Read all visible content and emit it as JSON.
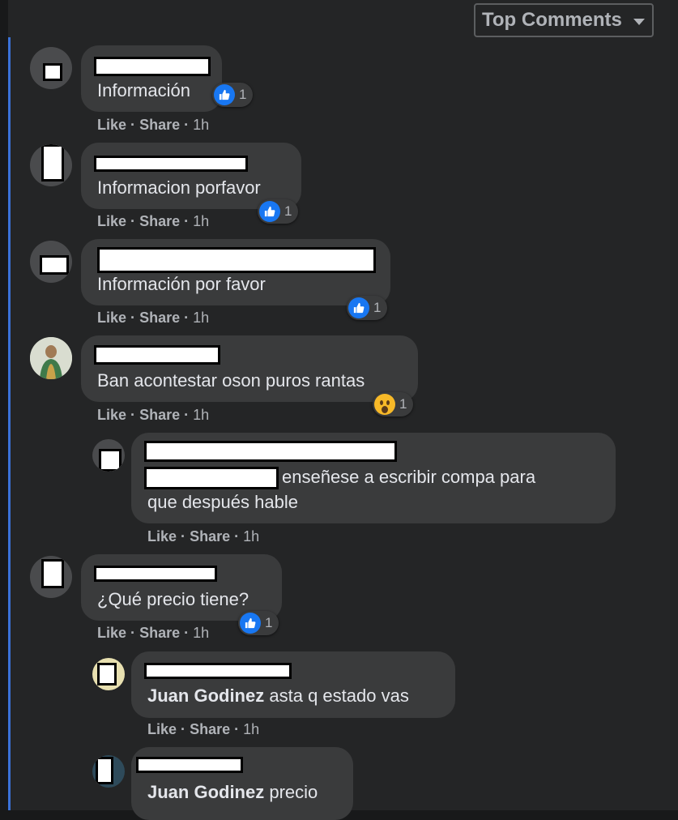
{
  "header": {
    "sort_label": "Top Comments"
  },
  "actions": {
    "like": "Like",
    "dot": "·",
    "share": "Share"
  },
  "comments": [
    {
      "text": "Información",
      "time": "1h",
      "reaction_count": "1"
    },
    {
      "text": "Informacion porfavor",
      "time": "1h",
      "reaction_count": "1"
    },
    {
      "text": "Información por favor",
      "time": "1h",
      "reaction_count": "1"
    },
    {
      "text": "Ban acontestar oson puros rantas",
      "time": "1h",
      "reaction_count": "1"
    },
    {
      "line1": "enseñese a escribir compa para",
      "line2": "que después hable",
      "time": "1h"
    },
    {
      "text": "¿Qué precio tiene?",
      "time": "1h",
      "reaction_count": "1"
    },
    {
      "mention": "Juan Godinez",
      "text": "asta q estado vas",
      "time": "1h"
    },
    {
      "mention": "Juan Godinez",
      "text": "precio"
    }
  ],
  "colors": {
    "accent": "#1877f2",
    "bubble": "#3a3b3c",
    "background": "#242526"
  }
}
